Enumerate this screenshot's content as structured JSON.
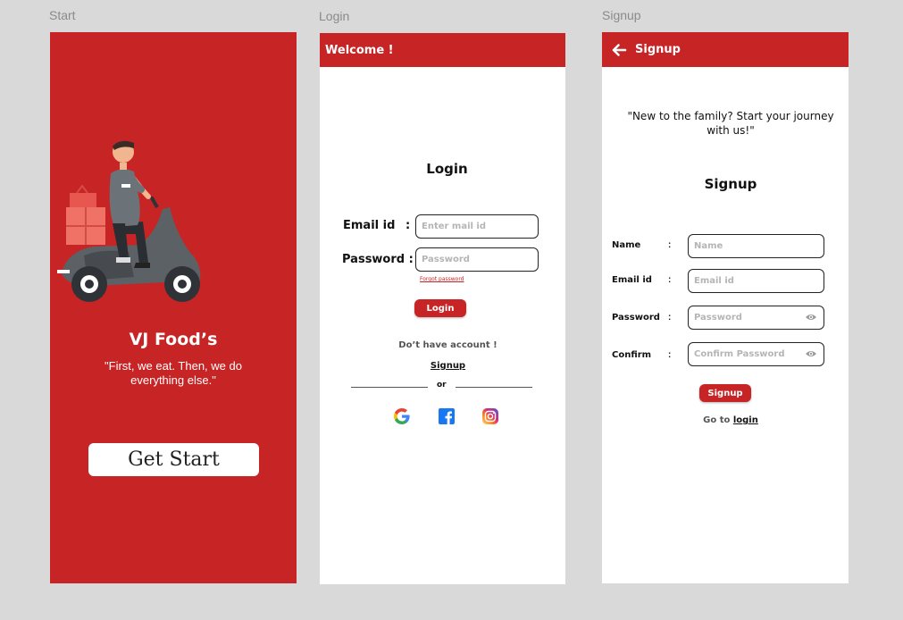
{
  "frames": {
    "start": "Start",
    "login": "Login",
    "signup": "Signup"
  },
  "start": {
    "brand_title": "VJ Food’s",
    "quote": "\"First, we eat. Then, we do everything else.\"",
    "get_start_label": "Get Start"
  },
  "login": {
    "appbar_title": "Welcome !",
    "title": "Login",
    "email_label": "Email id",
    "email_colon": ":",
    "email_placeholder": "Enter mail id",
    "password_label": "Password :",
    "password_placeholder": "Password",
    "forgot_label": "Forgot password",
    "login_button": "Login",
    "no_account": "Do’t have account !",
    "signup_link": "Signup",
    "or": "or",
    "social_icons": [
      "google-icon",
      "facebook-icon",
      "instagram-icon"
    ]
  },
  "signup": {
    "appbar_title": "Signup",
    "quote": "\"New to the family? Start your journey with us!\"",
    "title": "Signup",
    "fields": [
      {
        "label": "Name",
        "colon": ":",
        "placeholder": "Name"
      },
      {
        "label": "Email id",
        "colon": ":",
        "placeholder": "Email id"
      },
      {
        "label": "Password",
        "colon": ":",
        "placeholder": "Password"
      },
      {
        "label": "Confirm",
        "colon": ":",
        "placeholder": "Confirm Password"
      }
    ],
    "signup_button": "Signup",
    "goto_text": "Go to",
    "login_link": "login"
  },
  "colors": {
    "brand_red": "#c72426",
    "canvas": "#d9d9d9"
  }
}
